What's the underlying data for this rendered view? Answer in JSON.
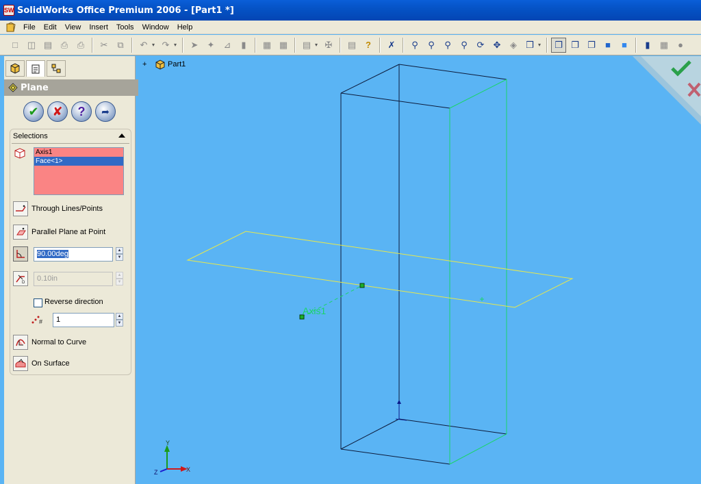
{
  "window": {
    "title": "SolidWorks Office Premium 2006 - [Part1 *]",
    "logo_text": "SW"
  },
  "menu": {
    "items": [
      "File",
      "Edit",
      "View",
      "Insert",
      "Tools",
      "Window",
      "Help"
    ]
  },
  "toolbar": {
    "icons": [
      "new-icon",
      "open-icon",
      "save-icon",
      "print-icon",
      "print-preview-icon",
      "cut-icon",
      "copy-icon",
      "undo-icon",
      "redo-icon",
      "select-icon",
      "smart-select-icon",
      "sketch-icon",
      "rebuild-icon",
      "options-icon",
      "grid-icon",
      "table-icon",
      "help-icon",
      "zoom-to-fit-icon",
      "zoom-area-icon",
      "zoom-in-out-icon",
      "zoom-selection-icon",
      "rotate-icon",
      "pan-icon",
      "section-view-icon",
      "view-orientation-icon",
      "wireframe-icon",
      "hidden-lines-visible-icon",
      "hidden-lines-removed-icon",
      "shaded-with-edges-icon",
      "shaded-icon",
      "shadows-icon",
      "perspective-icon",
      "realview-icon"
    ]
  },
  "feature_manager": {
    "tree_root": "Part1",
    "tree_expand": "+"
  },
  "property_manager": {
    "title": "Plane",
    "selections_label": "Selections",
    "selection_items": [
      "Axis1",
      "Face<1>"
    ],
    "options": {
      "through_lines": "Through Lines/Points",
      "parallel_plane": "Parallel Plane at Point",
      "angle_value": "90.00deg",
      "offset_value": "0.10in",
      "reverse_direction": "Reverse direction",
      "instances_value": "1",
      "normal_to_curve": "Normal to Curve",
      "on_surface": "On Surface"
    }
  },
  "viewport": {
    "axis_label": "Axis1",
    "triad": {
      "x": "X",
      "y": "Y",
      "z": "Z"
    }
  },
  "colors": {
    "background": "#5ab4f4",
    "plane_preview": "#e8e84a",
    "selected_face_edge": "#1ad46a",
    "model_edge": "#0c1a3a",
    "selection_list_bg": "#fa8484"
  }
}
